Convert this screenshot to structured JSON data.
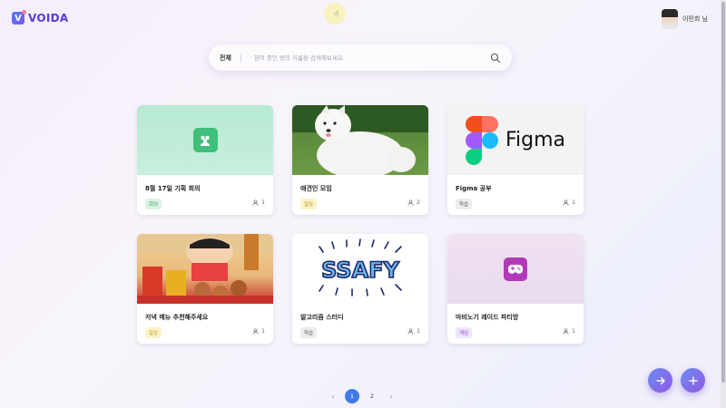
{
  "app": {
    "logo_letter": "V",
    "name": "VOIDA",
    "brand_color": "#5a3ad8"
  },
  "user": {
    "name": "이민희 님"
  },
  "search": {
    "category": "전체",
    "placeholder": "참여 중인 방의 이름을 검색해보세요."
  },
  "rooms": [
    {
      "title": "8월 17일 기획 회의",
      "tag": "회의",
      "members": "1",
      "thumbnail": "meeting-app-icon"
    },
    {
      "title": "애견인 모임",
      "tag": "일상",
      "members": "2",
      "thumbnail": "white-dog-photo"
    },
    {
      "title": "Figma 공부",
      "tag": "학습",
      "members": "1",
      "thumbnail": "figma-logo",
      "thumbnail_text": "Figma"
    },
    {
      "title": "저녁 메뉴 추천해주세요",
      "tag": "일상",
      "members": "1",
      "thumbnail": "cartoon-food-image"
    },
    {
      "title": "알고리즘 스터디",
      "tag": "학습",
      "members": "1",
      "thumbnail": "ssafy-logo",
      "thumbnail_text": "SSAFY"
    },
    {
      "title": "마비노기 레이드 파티방",
      "tag": "게임",
      "members": "1",
      "thumbnail": "game-controller-icon"
    }
  ],
  "pagination": {
    "pages": [
      "1",
      "2"
    ],
    "current": "1"
  },
  "actions": {
    "enter": "arrow-right-icon",
    "create": "plus-icon"
  },
  "colors": {
    "meeting": "#3ec07a",
    "daily": "#b89410",
    "study": "#555555",
    "game": "#8a4ac8",
    "accent": "#3f7be8"
  }
}
